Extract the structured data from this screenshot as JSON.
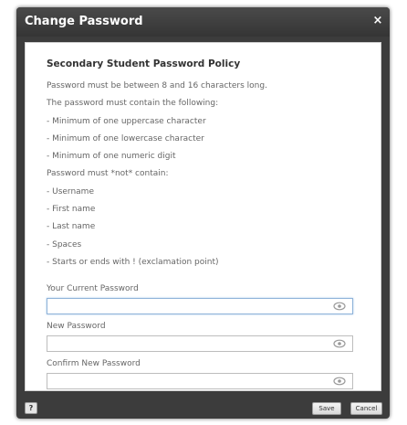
{
  "dialog": {
    "title": "Change Password",
    "close_glyph": "×"
  },
  "policy": {
    "heading": "Secondary Student Password Policy",
    "lines": [
      "Password must be between 8 and 16 characters long.",
      "The password must contain the following:",
      "- Minimum of one uppercase character",
      "- Minimum of one lowercase character",
      "- Minimum of one numeric digit",
      "Password must *not* contain:",
      "- Username",
      "- First name",
      "- Last name",
      "- Spaces",
      "- Starts or ends with ! (exclamation point)"
    ]
  },
  "fields": {
    "current": {
      "label": "Your Current Password",
      "value": "",
      "placeholder": ""
    },
    "new": {
      "label": "New Password",
      "value": "",
      "placeholder": ""
    },
    "confirm": {
      "label": "Confirm New Password",
      "value": "",
      "placeholder": ""
    }
  },
  "icons": {
    "visibility": "eye-icon",
    "help": "question-icon",
    "close": "close-icon"
  },
  "footer": {
    "help_label": "?",
    "save_label": "Save",
    "cancel_label": "Cancel"
  },
  "colors": {
    "titlebar": "#3c3c3c",
    "focus_border": "#8fb3d9"
  }
}
